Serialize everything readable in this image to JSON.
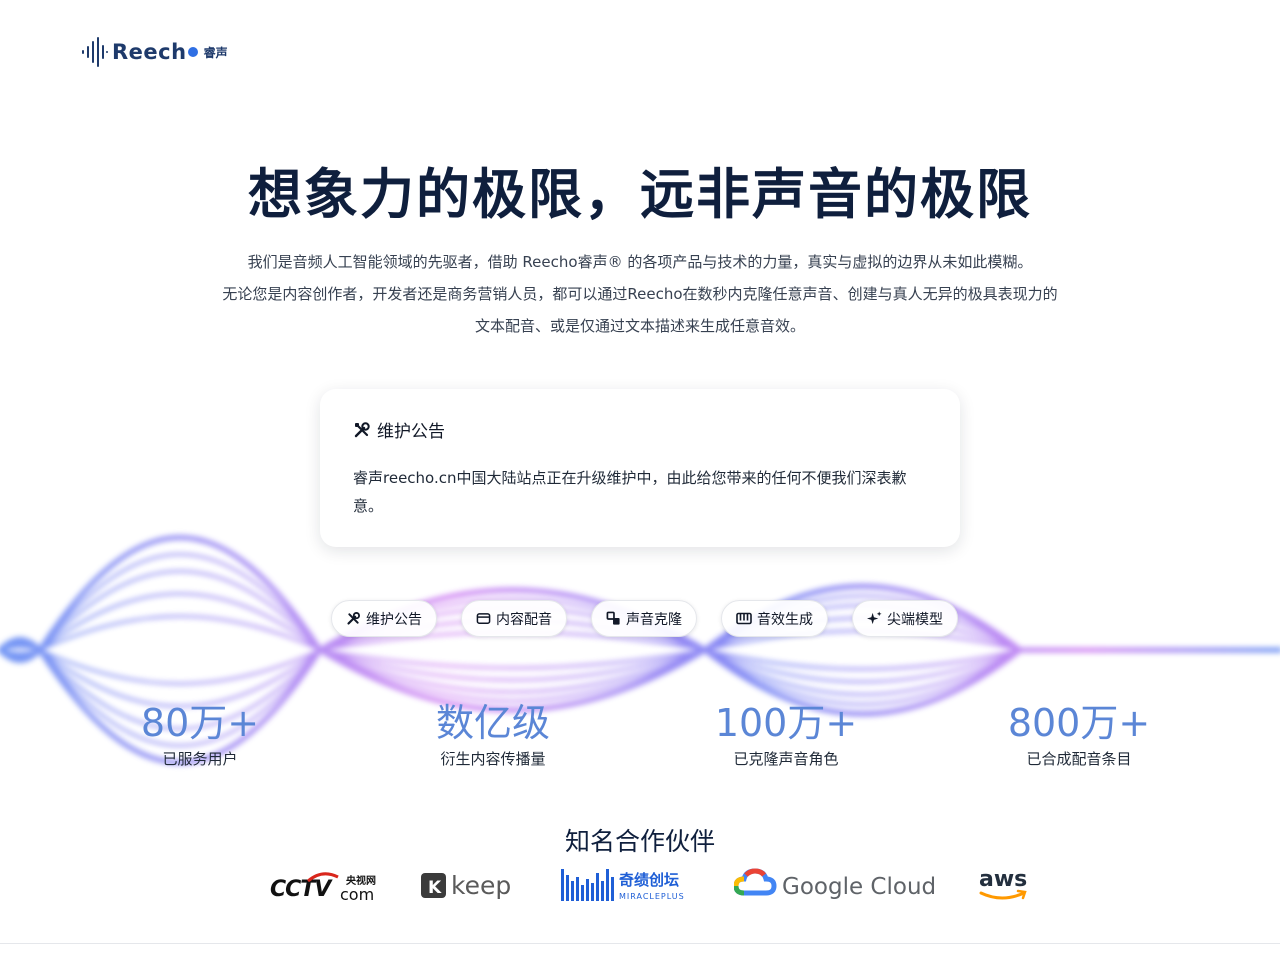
{
  "brand": {
    "name": "Reech",
    "name_cn": "睿声"
  },
  "hero": {
    "title": "想象力的极限，远非声音的极限",
    "lines": [
      "我们是音频人工智能领域的先驱者，借助 Reecho睿声® 的各项产品与技术的力量，真实与虚拟的边界从未如此模糊。",
      "无论您是内容创作者，开发者还是商务营销人员，都可以通过Reecho在数秒内克隆任意声音、创建与真人无异的极具表现力的",
      "文本配音、或是仅通过文本描述来生成任意音效。"
    ]
  },
  "notice": {
    "title": "维护公告",
    "icon": "tools-icon",
    "body": "睿声reecho.cn中国大陆站点正在升级维护中，由此给您带来的任何不便我们深表歉意。"
  },
  "tabs": [
    {
      "label": "维护公告",
      "icon": "tools-icon"
    },
    {
      "label": "内容配音",
      "icon": "card-icon"
    },
    {
      "label": "声音克隆",
      "icon": "clone-icon"
    },
    {
      "label": "音效生成",
      "icon": "keyboard-icon"
    },
    {
      "label": "尖端模型",
      "icon": "sparkle-icon"
    }
  ],
  "stats": [
    {
      "value": "80万+",
      "label": "已服务用户"
    },
    {
      "value": "数亿级",
      "label": "衍生内容传播量"
    },
    {
      "value": "100万+",
      "label": "已克隆声音角色"
    },
    {
      "value": "800万+",
      "label": "已合成配音条目"
    }
  ],
  "partners": {
    "title": "知名合作伙伴",
    "logos": [
      {
        "name": "CCTV.com",
        "cctv": "CCTV",
        "cn": "央视网",
        "com": "com"
      },
      {
        "name": "keep",
        "letter": "K",
        "word": "keep"
      },
      {
        "name": "奇绩创坛 MIRACLEPLUS",
        "cn": "奇绩创坛",
        "en": "MIRACLEPLUS"
      },
      {
        "name": "Google Cloud",
        "word": "Google Cloud"
      },
      {
        "name": "aws",
        "word": "aws"
      }
    ]
  },
  "colors": {
    "title": "#0f1f3d",
    "stat": "#5b86d6",
    "accent": "#2f6fe4",
    "wave_blue": "#4f7cf2",
    "wave_purple": "#c76cf0"
  }
}
